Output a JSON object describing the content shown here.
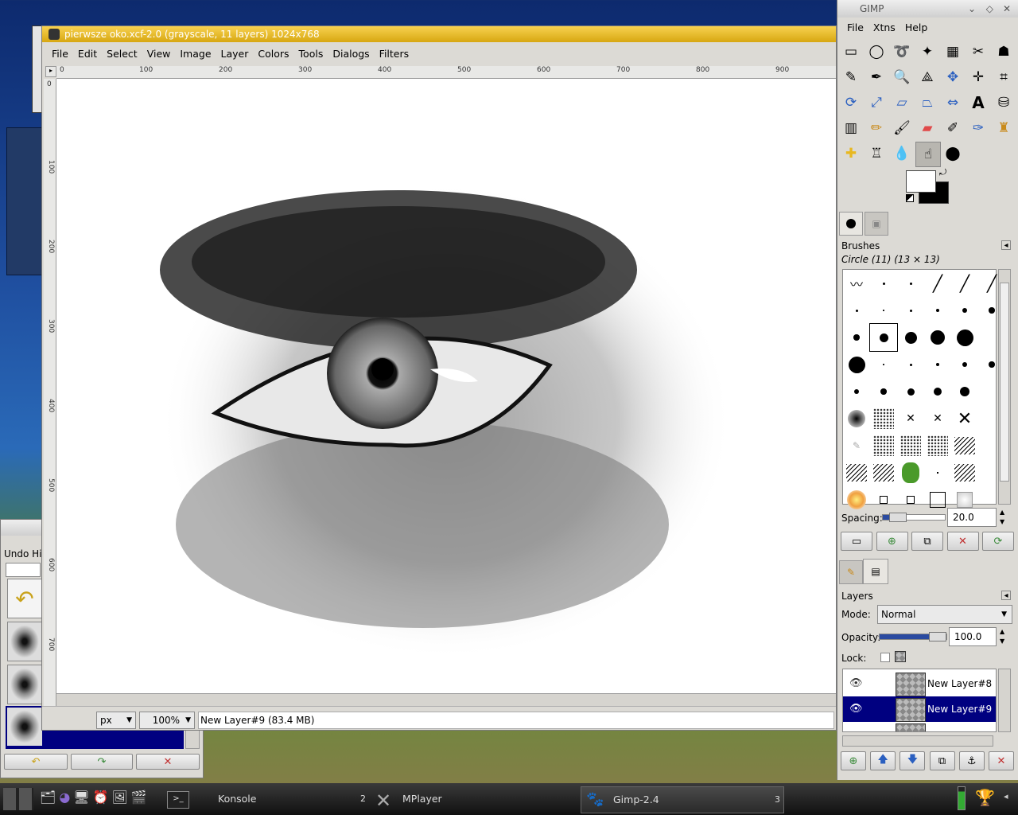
{
  "image_window": {
    "title": "pierwsze oko.xcf-2.0 (grayscale, 11 layers) 1024x768",
    "menu": [
      "File",
      "Edit",
      "Select",
      "View",
      "Image",
      "Layer",
      "Colors",
      "Tools",
      "Dialogs",
      "Filters"
    ],
    "ruler_marks": [
      "0",
      "100",
      "200",
      "300",
      "400",
      "500",
      "600",
      "700",
      "800",
      "900"
    ],
    "vruler_marks": [
      "0",
      "100",
      "200",
      "300",
      "400",
      "500",
      "600",
      "700"
    ],
    "unit": "px",
    "zoom": "100%",
    "status": "New Layer#9 (83.4 MB)"
  },
  "toolbox": {
    "title": "GIMP",
    "menu": [
      "File",
      "Xtns",
      "Help"
    ]
  },
  "brushes": {
    "title": "Brushes",
    "selected": "Circle (11) (13 × 13)",
    "spacing_label": "Spacing:",
    "spacing_value": "20.0",
    "spacing_fraction": 0.2
  },
  "layers": {
    "title": "Layers",
    "mode_label": "Mode:",
    "mode_value": "Normal",
    "opacity_label": "Opacity:",
    "opacity_value": "100.0",
    "opacity_fraction": 1.0,
    "lock_label": "Lock:",
    "items": [
      {
        "name": "New Layer#8",
        "selected": false
      },
      {
        "name": "New Layer#9",
        "selected": true
      }
    ]
  },
  "undo": {
    "title": "Undo Hi"
  },
  "taskbar": {
    "items": [
      {
        "label": "Konsole",
        "desk": "2"
      },
      {
        "label": "MPlayer",
        "desk": ""
      },
      {
        "label": "Gimp-2.4",
        "desk": "3"
      }
    ]
  },
  "colors": {
    "accent": "#000080",
    "titlebar": "#e8b820"
  }
}
